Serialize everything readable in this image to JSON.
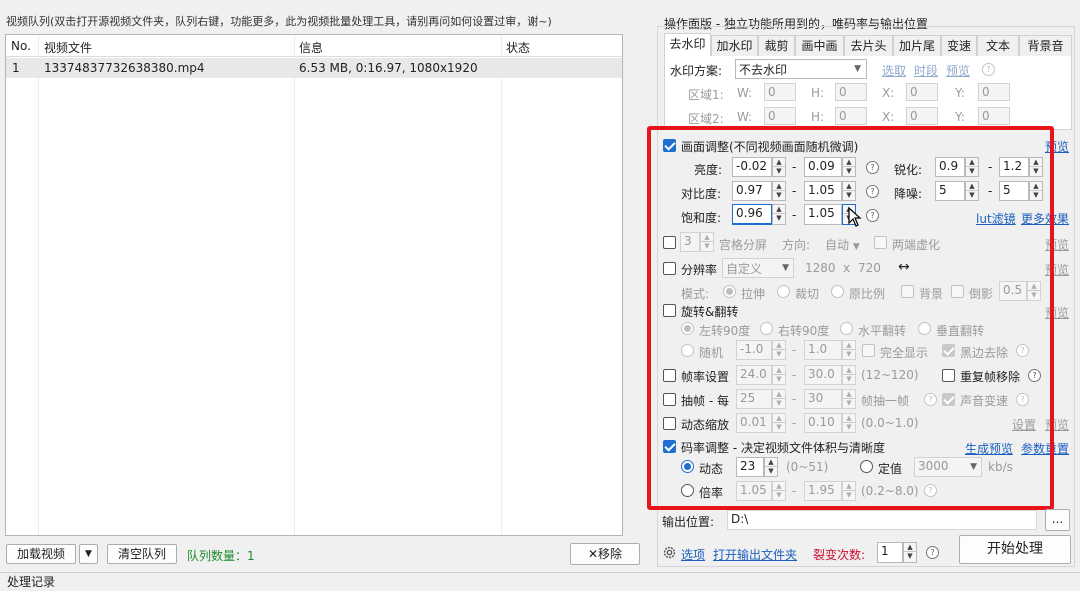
{
  "queue": {
    "notice": "视频队列(双击打开源视频文件夹，队列右键，功能更多，此为视频批量处理工具，请别再问如何设置过审，谢~)",
    "columns": [
      "No.",
      "视频文件",
      "信息",
      "状态"
    ],
    "rows": [
      {
        "no": "1",
        "file": "13374837732638380.mp4",
        "info": "6.53 MB, 0:16.97, 1080x1920",
        "status": ""
      }
    ],
    "load_btn": "加载视频",
    "clear_btn": "清空队列",
    "count_label": "队列数量：1",
    "remove_btn": "移除"
  },
  "log": {
    "title": "处理记录"
  },
  "panel": {
    "title": "操作面版 - 独立功能所用到的，唯码率与输出位置",
    "tabs": [
      "去水印",
      "加水印",
      "裁剪",
      "画中画",
      "去片头",
      "加片尾",
      "变速",
      "文本",
      "背景音"
    ],
    "active_tab": 0,
    "watermark": {
      "scheme_label": "水印方案:",
      "scheme_value": "不去水印",
      "select_link": "选取",
      "timeline_link": "时段",
      "preview_link": "预览",
      "region1": "区域1:",
      "region2": "区域2:",
      "w": "W:",
      "h": "H:",
      "x": "X:",
      "y": "Y:",
      "zero": "0"
    },
    "picture": {
      "title": "画面调整(不同视频画面随机微调)",
      "preview": "预览",
      "brightness_label": "亮度:",
      "brightness_min": "-0.02",
      "brightness_max": "0.09",
      "sharpen_label": "锐化:",
      "sharpen_min": "0.9",
      "sharpen_max": "1.2",
      "contrast_label": "对比度:",
      "contrast_min": "0.97",
      "contrast_max": "1.05",
      "denoise_label": "降噪:",
      "denoise_min": "5",
      "denoise_max": "5",
      "saturation_label": "饱和度:",
      "saturation_min": "0.96",
      "saturation_max": "1.05",
      "lut_link": "lut滤镜",
      "more_link": "更多效果",
      "dash": "-"
    },
    "grid": {
      "value": "3",
      "label": "宫格分屏",
      "dir_label": "方向:",
      "dir_value": "自动",
      "blur_label": "两端虚化",
      "preview": "预览"
    },
    "resolution": {
      "label": "分辨率",
      "mode_value": "自定义",
      "width": "1280",
      "x": "x",
      "height": "720",
      "swap": "↔",
      "preview": "预览",
      "mode_label": "模式:",
      "stretch": "拉伸",
      "crop": "裁切",
      "ratio": "原比例",
      "bg": "背景",
      "reflect": "倒影",
      "reflect_value": "0.5"
    },
    "rotate": {
      "label": "旋转&翻转",
      "preview": "预览",
      "left90": "左转90度",
      "right90": "右转90度",
      "hflip": "水平翻转",
      "vflip": "垂直翻转",
      "random": "随机",
      "min": "-1.0",
      "max": "1.0",
      "full_show": "完全显示",
      "black_remove": "黑边去除"
    },
    "framerate": {
      "label": "帧率设置",
      "min": "24.0",
      "max": "30.0",
      "range": "(12~120)",
      "dup_remove": "重复帧移除"
    },
    "extract": {
      "label": "抽帧 - 每",
      "min": "25",
      "max": "30",
      "unit": "帧抽一帧",
      "audio_speed": "声音变速"
    },
    "zoom": {
      "label": "动态缩放",
      "min": "0.01",
      "max": "0.10",
      "range": "(0.0~1.0)",
      "settings": "设置",
      "preview": "预览"
    },
    "bitrate": {
      "label": "码率调整 - 决定视频文件体积与清晰度",
      "gen_preview": "生成预览",
      "reset": "参数重置",
      "dynamic": "动态",
      "dynamic_value": "23",
      "dynamic_range": "(0~51)",
      "fixed": "定值",
      "fixed_value": "3000",
      "unit": "kb/s",
      "ratio": "倍率",
      "ratio_min": "1.05",
      "ratio_max": "1.95",
      "ratio_range": "(0.2~8.0)"
    },
    "output": {
      "label": "输出位置:",
      "path": "D:\\",
      "browse": "..."
    },
    "bottom": {
      "options": "选项",
      "open_folder": "打开输出文件夹",
      "fission_label": "裂变次数:",
      "fission_value": "1",
      "start": "开始处理"
    }
  },
  "colors": {
    "highlight": "#e8141c",
    "accent": "#1f6fd0",
    "link": "#1a5fc0"
  }
}
